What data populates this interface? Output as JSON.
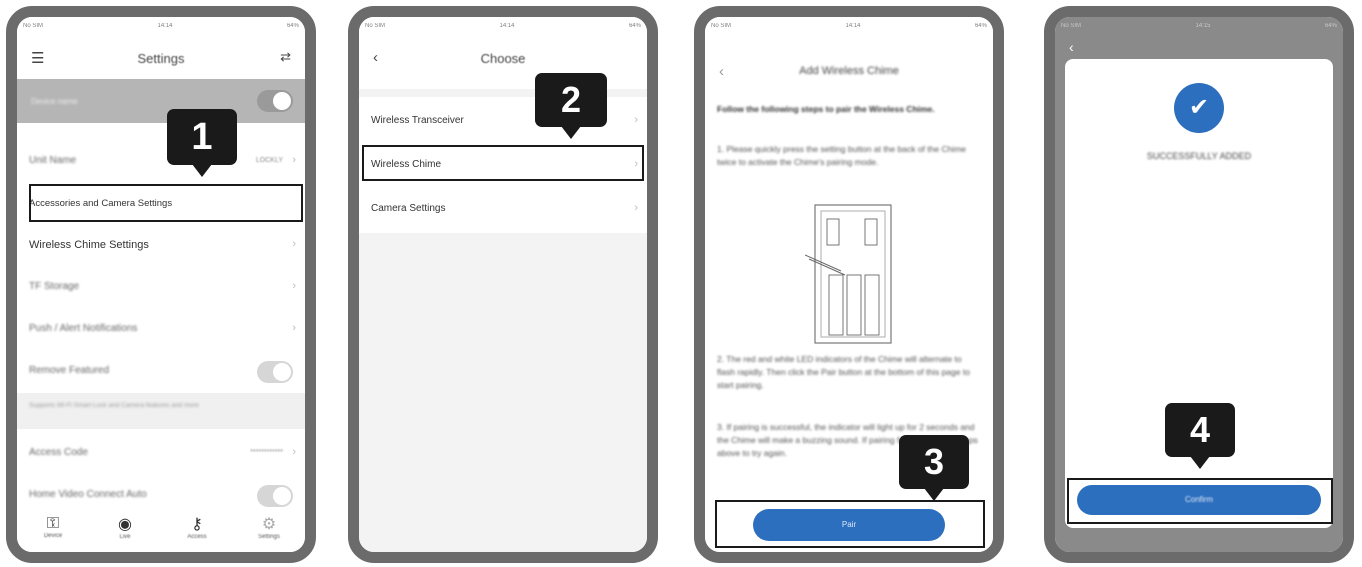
{
  "phones": [
    {
      "status": {
        "left": "No SIM",
        "time": "14:14",
        "right": "64%"
      },
      "nav": {
        "title": "Settings",
        "left_icon": "menu-icon",
        "right_icon": "share-icon"
      },
      "banner": {
        "text": "Device name"
      },
      "rows": [
        {
          "label": "Unit Name",
          "value": "LOCKLY"
        },
        {
          "label": "Accessories and Camera Settings"
        },
        {
          "label": "Wireless Chime Settings"
        },
        {
          "label": "TF Storage"
        },
        {
          "label": "Push / Alert Notifications"
        },
        {
          "label": "Remove Featured"
        },
        {
          "label": "Supports Wi-Fi Smart Lock and Camera features and more"
        },
        {
          "label": "Access Code",
          "value": "************"
        },
        {
          "label": "Home Video Connect Auto"
        }
      ],
      "tabs": [
        {
          "label": "Device",
          "icon": "lock-icon"
        },
        {
          "label": "Live",
          "icon": "camera-icon"
        },
        {
          "label": "Access",
          "icon": "key-icon"
        },
        {
          "label": "Settings",
          "icon": "gear-icon"
        }
      ],
      "step": "1"
    },
    {
      "status": {
        "left": "No SIM",
        "time": "14:14",
        "right": "64%"
      },
      "nav": {
        "title": "Choose",
        "left_icon": "back-icon"
      },
      "rows": [
        {
          "label": "Wireless Transceiver"
        },
        {
          "label": "Wireless Chime"
        },
        {
          "label": "Camera Settings"
        }
      ],
      "step": "2"
    },
    {
      "status": {
        "left": "No SIM",
        "time": "14:14",
        "right": "64%"
      },
      "nav": {
        "title": "Add Wireless Chime",
        "left_icon": "back-icon"
      },
      "heading": "Follow the following steps to pair the Wireless Chime.",
      "steps": [
        "1. Please quickly press the setting button at the back of the Chime twice to activate the Chime's pairing mode.",
        "2. The red and white LED indicators of the Chime will alternate to flash rapidly. Then click the Pair button at the bottom of this page to start pairing.",
        "3. If pairing is successful, the indicator will light up for 2 seconds and the Chime will make a buzzing sound. If pairing fails, repeat the steps above to try again."
      ],
      "button": "Pair",
      "step": "3"
    },
    {
      "status": {
        "left": "No SIM",
        "time": "14:15",
        "right": "64%"
      },
      "nav": {
        "left_icon": "back-icon"
      },
      "message": "SUCCESSFULLY ADDED",
      "button": "Confirm",
      "step": "4"
    }
  ]
}
